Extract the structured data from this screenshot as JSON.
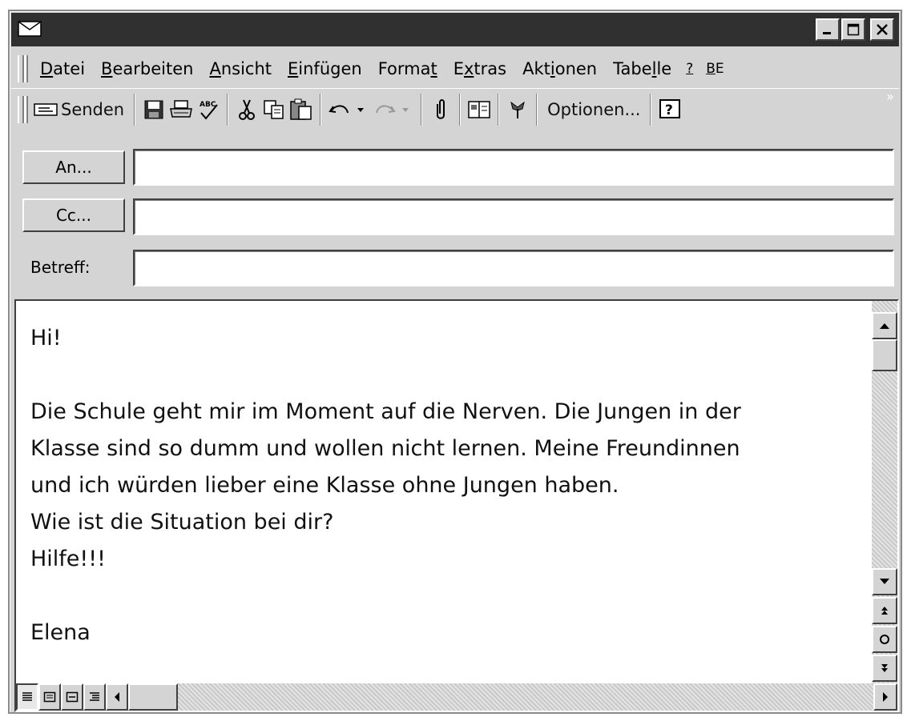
{
  "window": {
    "title_icon": "envelope-icon",
    "controls": [
      "minimize-icon",
      "maximize-icon",
      "close-icon"
    ]
  },
  "menubar": {
    "items": [
      {
        "label": "Datei",
        "key": "D"
      },
      {
        "label": "Bearbeiten",
        "key": "B"
      },
      {
        "label": "Ansicht",
        "key": "A"
      },
      {
        "label": "Einfügen",
        "key": "E"
      },
      {
        "label": "Format",
        "key": "t"
      },
      {
        "label": "Extras",
        "key": "x"
      },
      {
        "label": "Aktionen",
        "key": "i"
      },
      {
        "label": "Tabelle",
        "key": "l"
      },
      {
        "label": "?",
        "key": "?"
      },
      {
        "label": "BE",
        "key": "B"
      }
    ]
  },
  "toolbar": {
    "send_label": "Senden",
    "options_label": "Optionen...",
    "icons": [
      "send-icon",
      "save-icon",
      "print-icon",
      "spellcheck-icon",
      "cut-icon",
      "copy-icon",
      "paste-icon",
      "undo-icon",
      "redo-icon",
      "attach-icon",
      "address-book-icon",
      "flag-icon",
      "help-icon"
    ]
  },
  "header": {
    "to_button": "An...",
    "cc_button": "Cc...",
    "subject_label": "Betreff:",
    "to_value": "",
    "cc_value": "",
    "subject_value": ""
  },
  "message": {
    "greeting": "Hi!",
    "line1": "Die Schule geht mir im Moment auf die Nerven.  Die Jungen in der",
    "line2": "Klasse sind so dumm und wollen nicht lernen. Meine Freundinnen",
    "line3": "und ich würden lieber eine Klasse ohne Jungen haben.",
    "line4": "Wie ist die Situation bei dir?",
    "line5": "Hilfe!!!",
    "signature": "Elena"
  },
  "scrollbars": {
    "vertical_icons": [
      "scroll-up-icon",
      "scroll-down-icon",
      "prev-page-icon",
      "select-browse-object-icon",
      "next-page-icon"
    ],
    "horizontal_icons": [
      "normal-view-icon",
      "web-view-icon",
      "print-view-icon",
      "outline-view-icon",
      "scroll-left-icon",
      "scroll-right-icon"
    ]
  }
}
